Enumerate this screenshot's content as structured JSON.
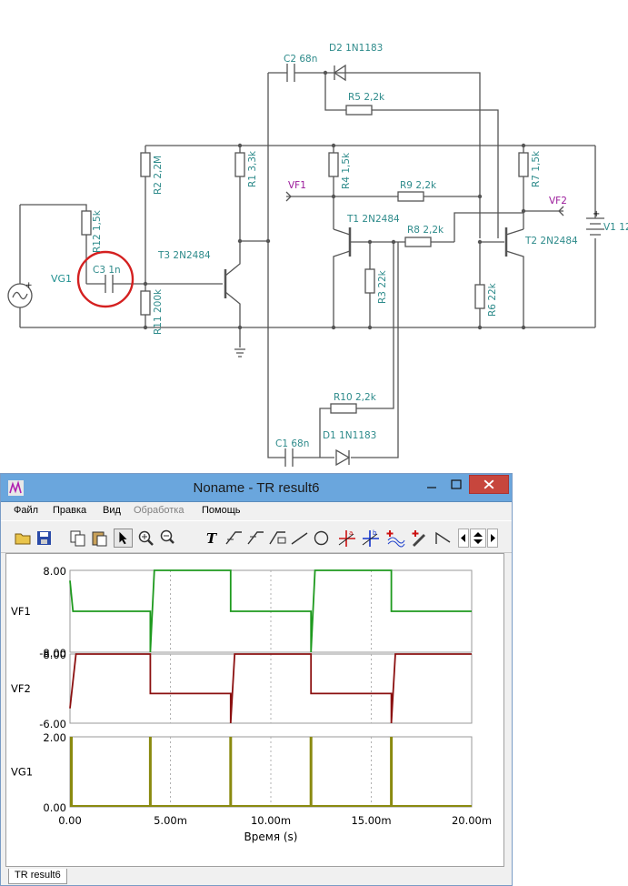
{
  "schematic": {
    "components": [
      {
        "id": "vg1",
        "label": "VG1"
      },
      {
        "id": "c3",
        "label": "C3 1n"
      },
      {
        "id": "r12",
        "label": "R12 1,5k"
      },
      {
        "id": "r11",
        "label": "R11 200k"
      },
      {
        "id": "r2",
        "label": "R2 2,2M"
      },
      {
        "id": "t3",
        "label": "T3 2N2484"
      },
      {
        "id": "r1",
        "label": "R1 3,3k"
      },
      {
        "id": "c2",
        "label": "C2 68n"
      },
      {
        "id": "d2",
        "label": "D2 1N1183"
      },
      {
        "id": "r5",
        "label": "R5 2,2k"
      },
      {
        "id": "vf1",
        "label": "VF1"
      },
      {
        "id": "r4",
        "label": "R4 1,5k"
      },
      {
        "id": "r9",
        "label": "R9 2,2k"
      },
      {
        "id": "t1",
        "label": "T1 2N2484"
      },
      {
        "id": "r8",
        "label": "R8 2,2k"
      },
      {
        "id": "r3",
        "label": "R3 22k"
      },
      {
        "id": "r7",
        "label": "R7 1,5k"
      },
      {
        "id": "vf2",
        "label": "VF2"
      },
      {
        "id": "t2",
        "label": "T2 2N2484"
      },
      {
        "id": "r6",
        "label": "R6 22k"
      },
      {
        "id": "v1",
        "label": "V1 12"
      },
      {
        "id": "r10",
        "label": "R10 2,2k"
      },
      {
        "id": "c1",
        "label": "C1 68n"
      },
      {
        "id": "d1",
        "label": "D1 1N1183"
      }
    ],
    "highlight_color": "#d42020"
  },
  "window": {
    "title": "Noname - TR result6",
    "menu": [
      {
        "label": "Файл",
        "enabled": true
      },
      {
        "label": "Правка",
        "enabled": true
      },
      {
        "label": "Вид",
        "enabled": true
      },
      {
        "label": "Обработка",
        "enabled": false
      },
      {
        "label": "Помощь",
        "enabled": true
      }
    ],
    "toolbar": [
      "open-icon",
      "save-icon",
      "copy-icon",
      "paste-icon",
      "pointer-icon",
      "zoom-in-icon",
      "zoom-100-icon",
      "text-icon",
      "cursor-a-icon",
      "cursor-b-icon",
      "marker-icon",
      "line-icon",
      "ellipse-icon",
      "cursor-a-red-icon",
      "cursor-b-blue-icon",
      "add-trace-icon",
      "pen-icon",
      "ramp-icon",
      "scroll-left-icon",
      "scroll-up-down-icon",
      "scroll-right-icon"
    ],
    "status_tab": "TR result6"
  },
  "chart_data": {
    "type": "line",
    "xlabel": "Время (s)",
    "x_ticks": [
      "0.00",
      "5.00m",
      "10.00m",
      "15.00m",
      "20.00m"
    ],
    "xlim": [
      0,
      0.02
    ],
    "panels": [
      {
        "name": "VF1",
        "color": "#1e9a1e",
        "ylim": [
          -8,
          8
        ],
        "ytick_labels": [
          "8.00",
          "-8.00"
        ],
        "x": [
          0,
          0.00015,
          0.004,
          0.004,
          0.0042,
          0.008,
          0.008,
          0.012,
          0.012,
          0.0122,
          0.016,
          0.016,
          0.02
        ],
        "y": [
          6.0,
          0.0,
          0.0,
          -8.0,
          8.0,
          8.0,
          0.0,
          0.0,
          -8.0,
          8.0,
          8.0,
          0.0,
          0.0
        ]
      },
      {
        "name": "VF2",
        "color": "#8b1010",
        "ylim": [
          -6,
          8
        ],
        "ytick_labels": [
          "8.00",
          "-6.00"
        ],
        "x": [
          0,
          0.0003,
          0.004,
          0.004,
          0.008,
          0.008,
          0.0082,
          0.012,
          0.012,
          0.016,
          0.016,
          0.0162,
          0.02
        ],
        "y": [
          -3.0,
          8.0,
          8.0,
          0.0,
          0.0,
          -6.0,
          8.0,
          8.0,
          0.0,
          0.0,
          -6.0,
          8.0,
          8.0
        ]
      },
      {
        "name": "VG1",
        "color": "#8a8a10",
        "ylim": [
          0,
          2
        ],
        "ytick_labels": [
          "2.00",
          "0.00"
        ],
        "pulses_at": [
          0.0,
          0.004,
          0.008,
          0.012,
          0.016
        ],
        "pulse_width": 5e-05,
        "x": [
          0,
          0.004,
          0.008,
          0.012,
          0.016,
          0.02
        ],
        "y": [
          0,
          0,
          0,
          0,
          0,
          0
        ]
      }
    ]
  }
}
